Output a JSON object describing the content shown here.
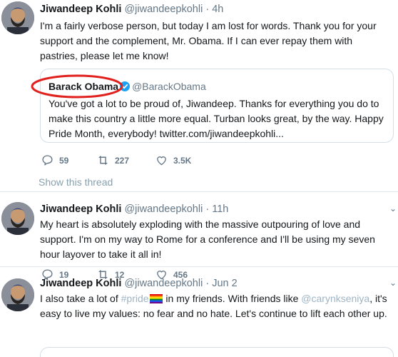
{
  "tweets": [
    {
      "name": "Jiwandeep Kohli",
      "handle": "@jiwandeepkohli",
      "separator": "·",
      "time": "4h",
      "text": "I'm a fairly verbose person, but today I am lost for words. Thank you for your support and the complement, Mr. Obama. If I can ever repay them with pastries, please let me know!",
      "quote": {
        "name": "Barack Obama",
        "handle": "@BarackObama",
        "text": "You've got a lot to be proud of, Jiwandeep. Thanks for everything you do to make this country a little more equal. Turban looks great, by the way. Happy Pride Month, everybody! twitter.com/jiwandeepkohli..."
      },
      "replies": "59",
      "retweets": "227",
      "likes": "3.5K",
      "show_thread": "Show this thread"
    },
    {
      "name": "Jiwandeep Kohli",
      "handle": "@jiwandeepkohli",
      "separator": "·",
      "time": "11h",
      "text": "My heart is absolutely exploding with the massive outpouring of love and support. I'm on my way to Rome for a conference and I'll be using my seven hour layover to take it all in!",
      "replies": "19",
      "retweets": "12",
      "likes": "456"
    },
    {
      "name": "Jiwandeep Kohli",
      "handle": "@jiwandeepkohli",
      "separator": "·",
      "time": "Jun 2",
      "text_part1": "I also take a lot of ",
      "hashtag": "#pride",
      "text_part2": " in my friends. With friends like ",
      "mention": "@carynkseniya",
      "text_part3": ", it's easy to live my values: no fear and no hate. Let's continue to lift each other up."
    }
  ],
  "icons": {
    "reply": "reply-icon",
    "retweet": "retweet-icon",
    "like": "heart-icon",
    "more": "chevron-down-icon",
    "verified": "verified-badge-icon",
    "flag": "rainbow-flag-icon"
  },
  "colors": {
    "text": "#14171a",
    "muted": "#657786",
    "link_faded": "#9fb4c4",
    "verified": "#1da1f2",
    "annotation": "#e0211d",
    "divider": "#e1e8ed"
  }
}
